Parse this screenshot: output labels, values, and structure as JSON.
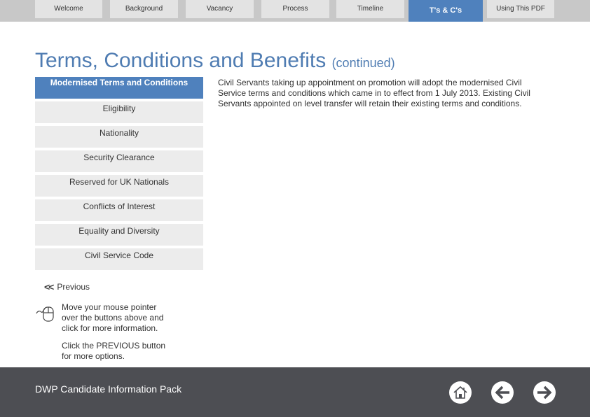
{
  "nav": {
    "tabs": [
      {
        "label": "Welcome",
        "active": false
      },
      {
        "label": "Background",
        "active": false
      },
      {
        "label": "Vacancy",
        "active": false
      },
      {
        "label": "Process",
        "active": false
      },
      {
        "label": "Timeline",
        "active": false
      },
      {
        "label": "T's & C's",
        "active": true
      },
      {
        "label": "Using This PDF",
        "active": false
      }
    ]
  },
  "page": {
    "title": "Terms, Conditions and Benefits",
    "title_suffix": "(continued)"
  },
  "menu": {
    "items": [
      {
        "label": "Modernised Terms and Conditions",
        "active": true
      },
      {
        "label": "Eligibility",
        "active": false
      },
      {
        "label": "Nationality",
        "active": false
      },
      {
        "label": "Security Clearance",
        "active": false
      },
      {
        "label": "Reserved for UK Nationals",
        "active": false
      },
      {
        "label": "Conflicts of Interest",
        "active": false
      },
      {
        "label": "Equality and Diversity",
        "active": false
      },
      {
        "label": "Civil Service Code",
        "active": false
      }
    ]
  },
  "content": {
    "body": "Civil Servants taking up appointment on promotion will adopt the modernised Civil Service terms and conditions which came in to effect from 1 July 2013. Existing Civil Servants appointed on level transfer will retain their existing terms and conditions."
  },
  "help": {
    "previous_label": "Previous",
    "previous_icon": "double-chevron-left-icon",
    "mouse_icon": "mouse-icon",
    "instruction_1": "Move your mouse pointer over the buttons above and click for more information.",
    "instruction_2": "Click the PREVIOUS button for more options."
  },
  "footer": {
    "title": "DWP Candidate Information Pack",
    "buttons": [
      {
        "name": "home",
        "icon": "home-icon"
      },
      {
        "name": "back",
        "icon": "arrow-left-icon"
      },
      {
        "name": "forward",
        "icon": "arrow-right-icon"
      }
    ]
  },
  "colors": {
    "accent": "#4f81bd",
    "title": "#4f7cb2",
    "nav_bg": "#c8c8c8",
    "tab_bg": "#e3e3e3",
    "menu_bg": "#ececec",
    "footer_bg": "#4d4e53"
  }
}
